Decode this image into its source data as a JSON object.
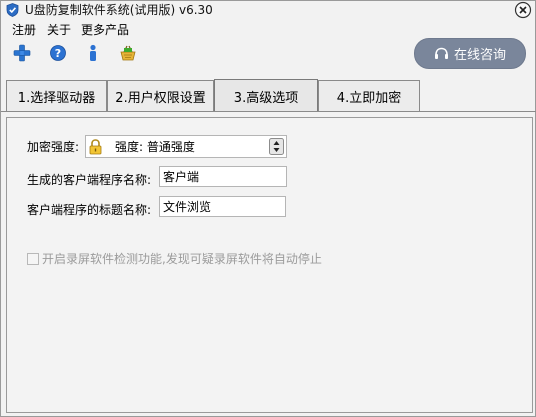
{
  "window": {
    "title": "U盘防复制软件系统(试用版) v6.30"
  },
  "menu": {
    "items": [
      "注册",
      "关于",
      "更多产品"
    ]
  },
  "toolbar": {
    "icons": [
      "add-icon",
      "help-icon",
      "info-icon",
      "basket-icon"
    ],
    "online_button": "在线咨询"
  },
  "tabs": [
    {
      "label": "1.选择驱动器",
      "active": false
    },
    {
      "label": "2.用户权限设置",
      "active": false
    },
    {
      "label": "3.高级选项",
      "active": true
    },
    {
      "label": "4.立即加密",
      "active": false
    }
  ],
  "form": {
    "strength_label": "加密强度:",
    "strength_value": "强度: 普通强度",
    "client_name_label": "生成的客户端程序名称:",
    "client_name_value": "客户端",
    "client_title_label": "客户端程序的标题名称:",
    "client_title_value": "文件浏览",
    "screen_record_label": "开启录屏软件检测功能,发现可疑录屏软件将自动停止",
    "screen_record_checked": false
  },
  "colors": {
    "online_button_bg": "#7a869b",
    "disabled_text": "#9b9b9b"
  }
}
